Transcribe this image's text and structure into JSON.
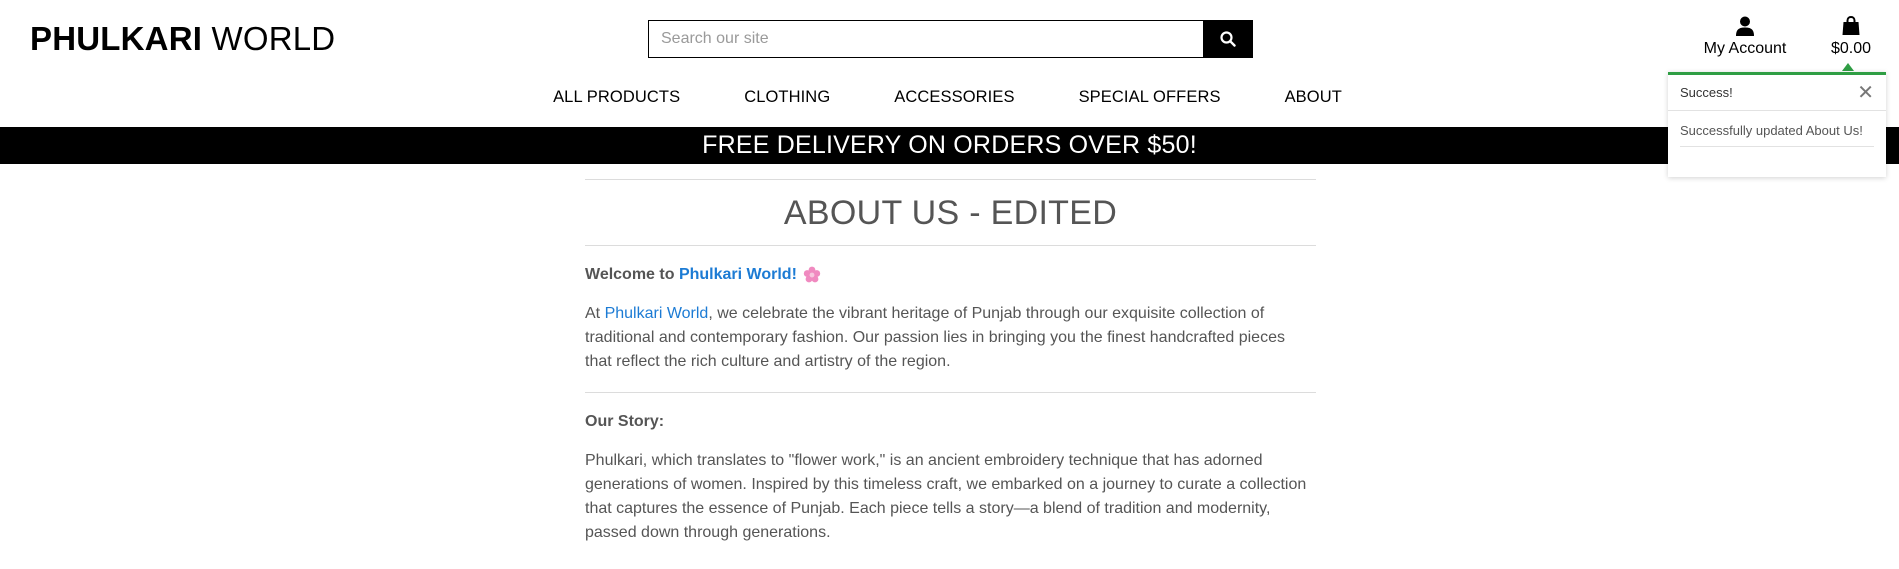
{
  "header": {
    "logo_bold": "PHULKARI",
    "logo_light": " WORLD",
    "search_placeholder": "Search our site",
    "account_label": "My Account",
    "bag_total": "$0.00"
  },
  "nav": {
    "items": [
      "ALL PRODUCTS",
      "CLOTHING",
      "ACCESSORIES",
      "SPECIAL OFFERS",
      "ABOUT"
    ]
  },
  "banner": {
    "text": "FREE DELIVERY ON ORDERS OVER $50!"
  },
  "content": {
    "title": "ABOUT US - EDITED",
    "welcome_prefix": "Welcome to ",
    "welcome_link": "Phulkari World!",
    "intro_prefix": "At ",
    "intro_link": "Phulkari World",
    "intro_rest": ", we celebrate the vibrant heritage of Punjab through our exquisite collection of traditional and contemporary fashion. Our passion lies in bringing you the finest handcrafted pieces that reflect the rich culture and artistry of the region.",
    "story_heading": "Our Story:",
    "story_text": "Phulkari, which translates to \"flower work,\" is an ancient embroidery technique that has adorned generations of women. Inspired by this timeless craft, we embarked on a journey to curate a collection that captures the essence of Punjab. Each piece tells a story—a blend of tradition and modernity, passed down through generations."
  },
  "toast": {
    "title": "Success!",
    "message": "Successfully updated About Us!",
    "close_glyph": "✕"
  },
  "colors": {
    "accent_link": "#1c7bd4",
    "success": "#2f9e44",
    "banner_bg": "#000000"
  },
  "icons": {
    "search": "search-icon",
    "account": "user-icon",
    "bag": "shopping-bag-icon",
    "flower": "flower-emoji-icon"
  }
}
